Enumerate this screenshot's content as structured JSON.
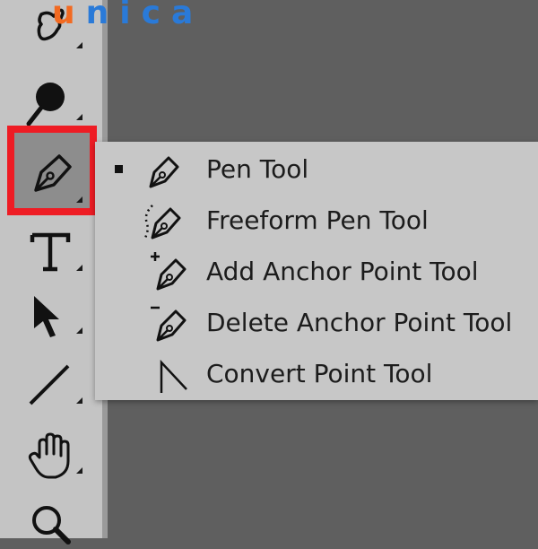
{
  "logo": {
    "first": "u",
    "rest": "nica"
  },
  "toolbar": {
    "tools": [
      {
        "name": "smudge-tool",
        "icon": "smudge-finger-icon"
      },
      {
        "name": "burn-tool",
        "icon": "burn-icon"
      },
      {
        "name": "pen-tool",
        "icon": "pen-icon",
        "active": true
      },
      {
        "name": "type-tool",
        "icon": "type-icon"
      },
      {
        "name": "path-selection-tool",
        "icon": "arrow-pointer-icon"
      },
      {
        "name": "line-tool",
        "icon": "line-icon"
      },
      {
        "name": "hand-tool",
        "icon": "hand-icon"
      },
      {
        "name": "zoom-tool",
        "icon": "magnifier-icon"
      }
    ],
    "highlight_color": "#ee1c24"
  },
  "flyout": {
    "items": [
      {
        "label": "Pen Tool",
        "icon": "pen-icon",
        "selected": true
      },
      {
        "label": "Freeform Pen Tool",
        "icon": "freeform-pen-icon",
        "selected": false
      },
      {
        "label": "Add Anchor Point Tool",
        "icon": "add-anchor-point-icon",
        "selected": false
      },
      {
        "label": "Delete Anchor Point Tool",
        "icon": "delete-anchor-point-icon",
        "selected": false
      },
      {
        "label": "Convert Point Tool",
        "icon": "convert-point-icon",
        "selected": false
      }
    ]
  }
}
